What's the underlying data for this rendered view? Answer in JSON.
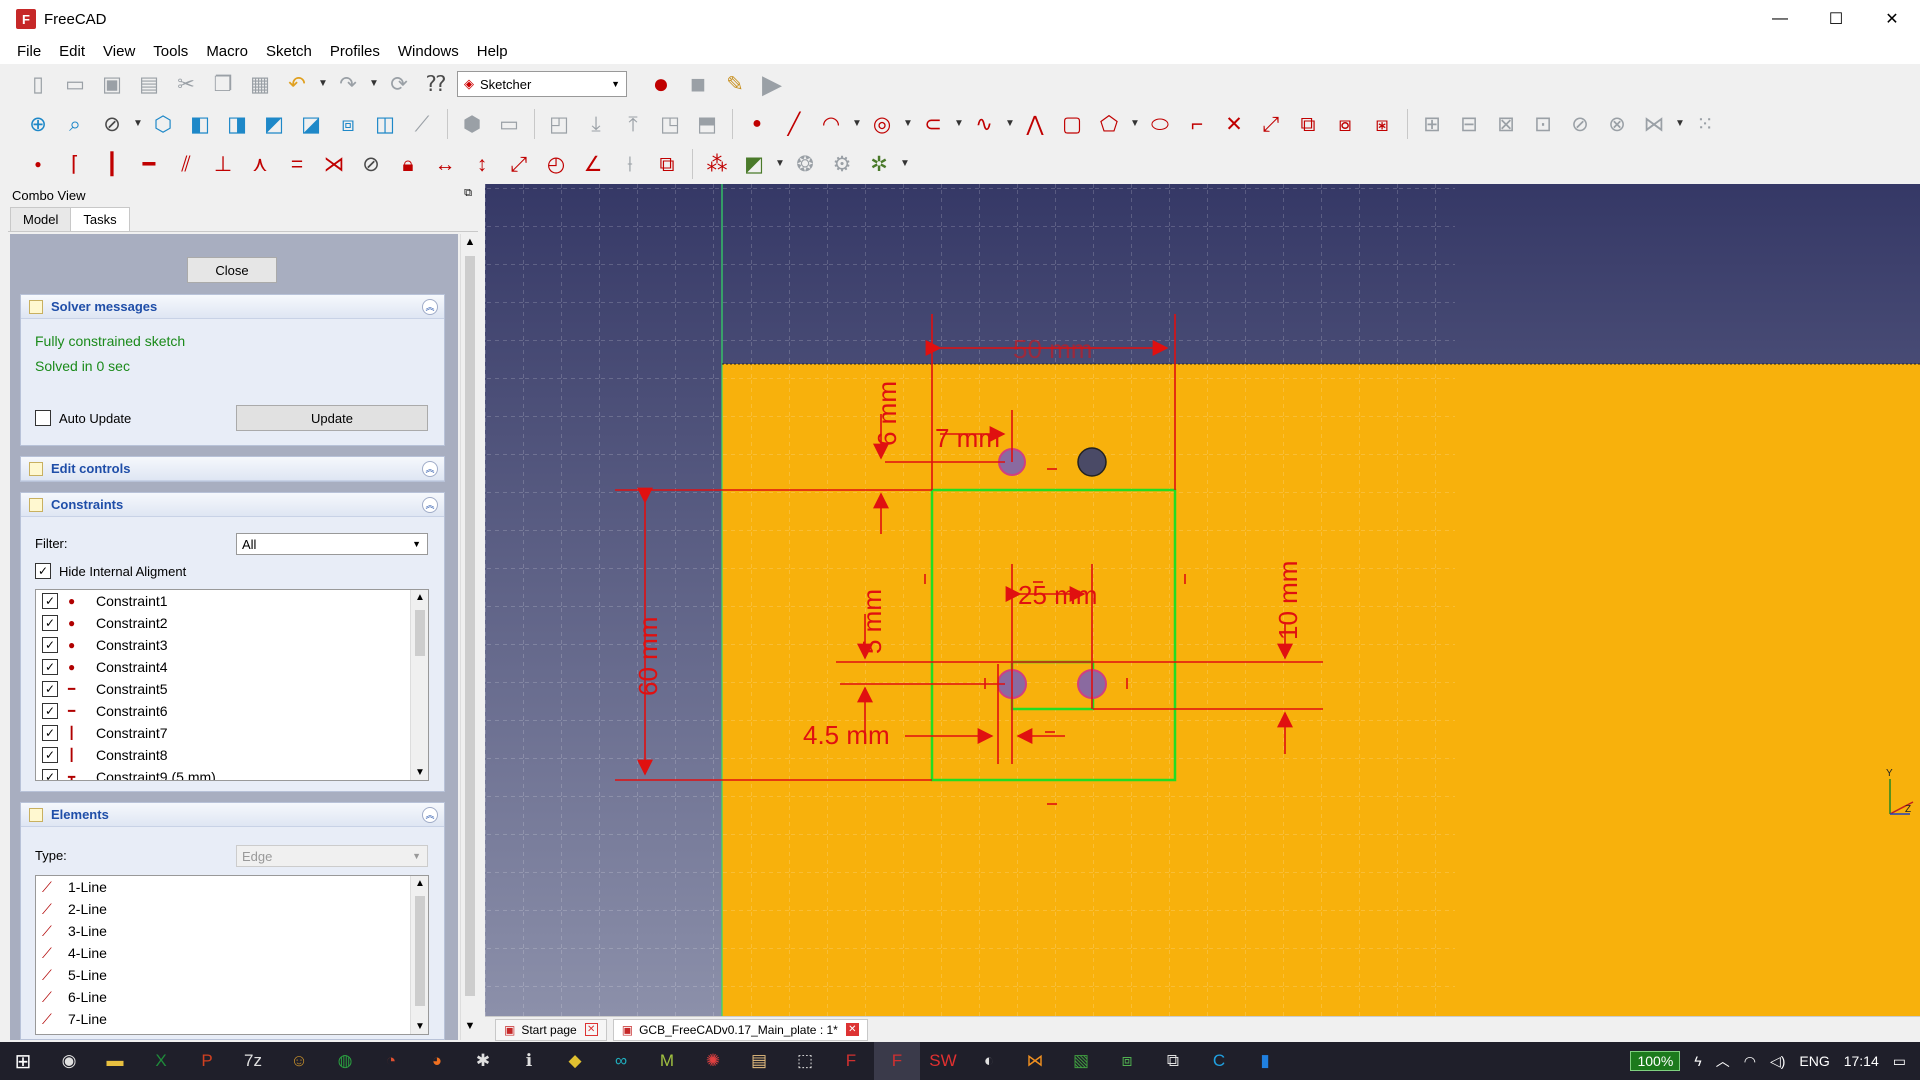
{
  "window": {
    "title": "FreeCAD",
    "controls": [
      "—",
      "☐",
      "✕"
    ]
  },
  "menu": [
    "File",
    "Edit",
    "View",
    "Tools",
    "Macro",
    "Sketch",
    "Profiles",
    "Windows",
    "Help"
  ],
  "workbench": {
    "selected": "Sketcher"
  },
  "combo_view": {
    "title": "Combo View",
    "tabs": [
      "Model",
      "Tasks"
    ],
    "active_tab": "Tasks",
    "close_label": "Close",
    "solver": {
      "title": "Solver messages",
      "status": "Fully constrained sketch",
      "time": "Solved in 0 sec",
      "auto_update_label": "Auto Update",
      "auto_update_checked": false,
      "update_label": "Update"
    },
    "edit_controls": {
      "title": "Edit controls"
    },
    "constraints": {
      "title": "Constraints",
      "filter_label": "Filter:",
      "filter_value": "All",
      "hide_internal_label": "Hide Internal Aligment",
      "items": [
        {
          "label": "Constraint1",
          "icon": "coincident-icon",
          "glyph": "●"
        },
        {
          "label": "Constraint2",
          "icon": "coincident-icon",
          "glyph": "●"
        },
        {
          "label": "Constraint3",
          "icon": "coincident-icon",
          "glyph": "●"
        },
        {
          "label": "Constraint4",
          "icon": "coincident-icon",
          "glyph": "●"
        },
        {
          "label": "Constraint5",
          "icon": "horizontal-icon",
          "glyph": "━"
        },
        {
          "label": "Constraint6",
          "icon": "horizontal-icon",
          "glyph": "━"
        },
        {
          "label": "Constraint7",
          "icon": "vertical-icon",
          "glyph": "┃"
        },
        {
          "label": "Constraint8",
          "icon": "vertical-icon",
          "glyph": "┃"
        },
        {
          "label": "Constraint9 (5 mm)",
          "icon": "distance-icon",
          "glyph": "┳"
        }
      ]
    },
    "elements": {
      "title": "Elements",
      "type_label": "Type:",
      "type_value": "Edge",
      "items": [
        "1-Line",
        "2-Line",
        "3-Line",
        "4-Line",
        "5-Line",
        "6-Line",
        "7-Line"
      ]
    }
  },
  "viewport": {
    "dimensions": [
      "50 mm",
      "6 mm",
      "7 mm",
      "25 mm",
      "5 mm",
      "60 mm",
      "10 mm",
      "4.5 mm"
    ],
    "colors": {
      "top_bg": "#353866",
      "bottom_bg": "#8c90aa",
      "plate": "#f8b10c",
      "constraint": "#e01010",
      "geometry": "#22dd22"
    },
    "axis": {
      "y": "Y",
      "z": "Z"
    }
  },
  "doc_tabs": [
    {
      "label": "Start page",
      "active": false
    },
    {
      "label": "GCB_FreeCADv0.17_Main_plate : 1*",
      "active": true
    }
  ],
  "tray": {
    "battery": "100%",
    "language": "ENG",
    "time": "17:14"
  }
}
